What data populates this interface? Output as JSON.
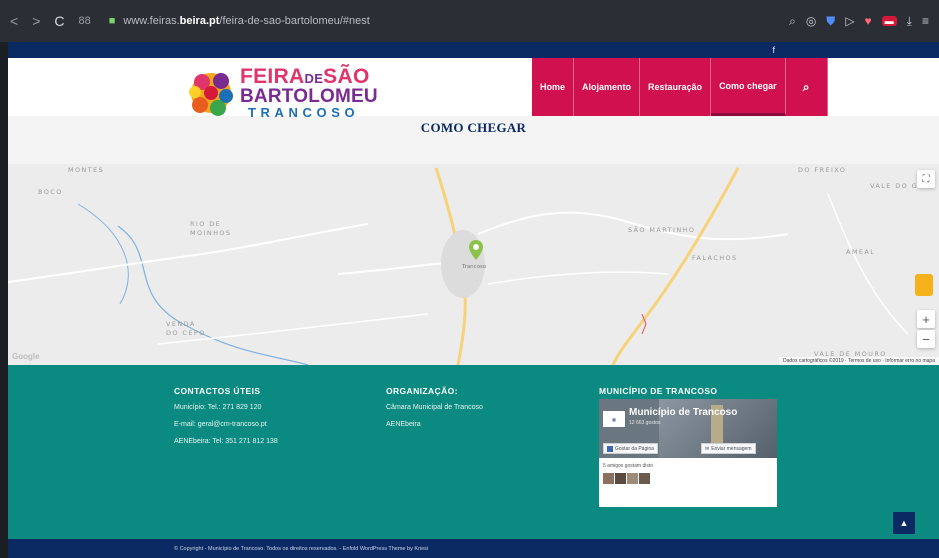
{
  "browser": {
    "back": "<",
    "forward": ">",
    "reload": "C",
    "grid": "88",
    "url_prefix": "www.feiras.",
    "url_domain": "beira.pt",
    "url_path": "/feira-de-sao-bartolomeu/#nest",
    "icons": [
      "search-icon",
      "camera-icon",
      "shield-icon",
      "send-icon",
      "heart-icon",
      "extension-icon",
      "download-icon",
      "menu-icon"
    ]
  },
  "top_strip": {
    "social": "f"
  },
  "logo": {
    "line1_a": "FEIRA",
    "line1_de": "DE",
    "line1_b": "SÃO",
    "line2": "BARTOLOMEU",
    "line3": "TRANCOSO"
  },
  "menu": {
    "items": [
      {
        "label": "Home"
      },
      {
        "label": "Alojamento"
      },
      {
        "label": "Restauração"
      },
      {
        "label": "Como chegar"
      }
    ],
    "search_icon": "search-icon"
  },
  "page_title": "COMO CHEGAR",
  "map": {
    "labels": [
      {
        "text": "MONTES"
      },
      {
        "text": "BOCO"
      },
      {
        "text": "RIO DE MOINHOS"
      },
      {
        "text": "SÃO MARTINHO"
      },
      {
        "text": "FALACHOS"
      },
      {
        "text": "AMEAL"
      },
      {
        "text": "DO FREIXO"
      },
      {
        "text": "VALE DO GL"
      },
      {
        "text": "VENDA DO CEPO"
      },
      {
        "text": "VALE DE MOURO"
      },
      {
        "text": "Trancoso"
      }
    ],
    "google": "Google",
    "attribution": "Dados cartográficos ©2019 · Termos de uso · Informar erro no mapa",
    "zoom_in": "+",
    "zoom_out": "−",
    "fullscreen": "⛶"
  },
  "footer": {
    "contactos": {
      "title": "CONTACTOS ÚTEIS",
      "lines": [
        "Município: Tel.: 271 829 120",
        "E-mail: geral@cm-trancoso.pt",
        "AENEbeira: Tel: 351 271 812 138"
      ]
    },
    "organizacao": {
      "title": "ORGANIZAÇÃO:",
      "lines": [
        "Câmara Municipal de Trancoso",
        "AENEbeira"
      ]
    },
    "municipio": {
      "title": "MUNICÍPIO DE TRANCOSO",
      "fb_name": "Município de Trancoso",
      "fb_likes": "12 663 gostos",
      "fb_like_btn": "Gostar da Página",
      "fb_msg_btn": "Enviar mensagem",
      "fb_friends": "5 amigos gostam disto"
    },
    "to_top": "▲"
  },
  "copyright": "© Copyright - Município de Trancoso. Todos os direitos reservados. - Enfold WordPress Theme by Kriesi",
  "colors": {
    "brand_pink": "#d1104f",
    "navy": "#0b2a63",
    "teal": "#0a8a80"
  }
}
